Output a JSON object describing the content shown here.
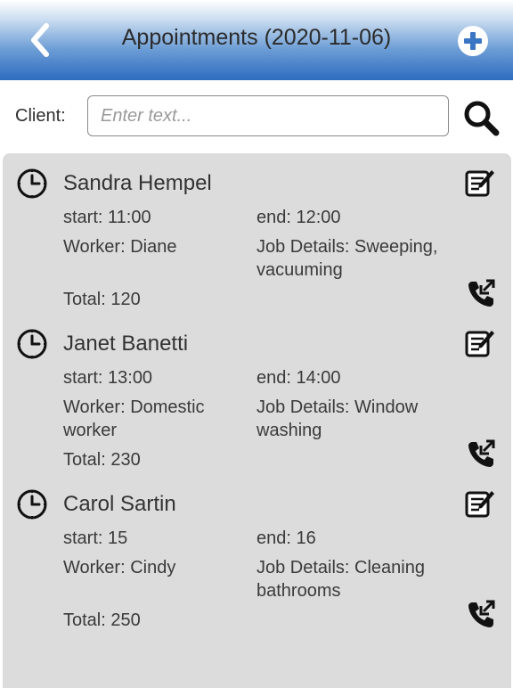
{
  "header": {
    "title": "Appointments (2020-11-06)"
  },
  "search": {
    "label": "Client:",
    "placeholder": "Enter text...",
    "value": ""
  },
  "appointments": [
    {
      "name": "Sandra Hempel",
      "start": "start: 11:00",
      "end": "end: 12:00",
      "worker": "Worker: Diane",
      "job": "Job Details: Sweeping, vacuuming",
      "total": "Total: 120"
    },
    {
      "name": "Janet Banetti",
      "start": "start: 13:00",
      "end": "end: 14:00",
      "worker": "Worker: Domestic worker",
      "job": "Job Details: Window washing",
      "total": "Total: 230"
    },
    {
      "name": "Carol Sartin",
      "start": "start: 15",
      "end": "end: 16",
      "worker": "Worker: Cindy",
      "job": "Job Details: Cleaning bathrooms",
      "total": "Total: 250"
    }
  ],
  "icons": {
    "back": "chevron-left-icon",
    "add": "plus-circle-icon",
    "search": "magnifier-icon",
    "clock": "clock-icon",
    "edit": "edit-note-icon",
    "call": "phone-callback-icon"
  },
  "colors": {
    "header_top": "#ffffff",
    "header_bottom": "#2d6cc0",
    "list_bg": "#dcdcdc"
  }
}
